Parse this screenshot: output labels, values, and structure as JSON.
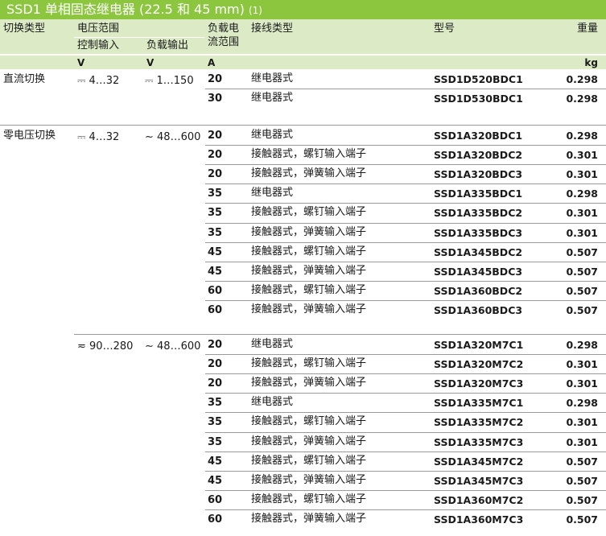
{
  "title": {
    "main": "SSD1 单相固态继电器 (22.5 和 45 mm)",
    "note": "(1)"
  },
  "header": {
    "switch_type": "切换类型",
    "voltage_range": "电压范围",
    "control_input": "控制输入",
    "load_output": "负载输出",
    "load_current_line1": "负载电",
    "load_current_line2": "流范围",
    "connection_type": "接线类型",
    "model": "型号",
    "weight": "重量"
  },
  "units": {
    "control": "V",
    "load": "V",
    "current": "A",
    "weight": "kg"
  },
  "groups": [
    {
      "switch_type": "直流切换",
      "control": "⎓ 4…32",
      "load": "⎓ 1…150",
      "rows": [
        {
          "current": "20",
          "connection": "继电器式",
          "model": "SSD1D520BDC1",
          "weight": "0.298"
        },
        {
          "current": "30",
          "connection": "继电器式",
          "model": "SSD1D530BDC1",
          "weight": "0.298"
        }
      ]
    },
    {
      "switch_type": "零电压切换",
      "control": "⎓ 4…32",
      "load": "∼ 48…600",
      "rows": [
        {
          "current": "20",
          "connection": "继电器式",
          "model": "SSD1A320BDC1",
          "weight": "0.298"
        },
        {
          "current": "20",
          "connection": "接触器式，螺钉输入端子",
          "model": "SSD1A320BDC2",
          "weight": "0.301"
        },
        {
          "current": "20",
          "connection": "接触器式，弹簧输入端子",
          "model": "SSD1A320BDC3",
          "weight": "0.301"
        },
        {
          "current": "35",
          "connection": "继电器式",
          "model": "SSD1A335BDC1",
          "weight": "0.298"
        },
        {
          "current": "35",
          "connection": "接触器式，螺钉输入端子",
          "model": "SSD1A335BDC2",
          "weight": "0.301"
        },
        {
          "current": "35",
          "connection": "接触器式，弹簧输入端子",
          "model": "SSD1A335BDC3",
          "weight": "0.301"
        },
        {
          "current": "45",
          "connection": "接触器式，螺钉输入端子",
          "model": "SSD1A345BDC2",
          "weight": "0.507"
        },
        {
          "current": "45",
          "connection": "接触器式，弹簧输入端子",
          "model": "SSD1A345BDC3",
          "weight": "0.507"
        },
        {
          "current": "60",
          "connection": "接触器式，螺钉输入端子",
          "model": "SSD1A360BDC2",
          "weight": "0.507"
        },
        {
          "current": "60",
          "connection": "接触器式，弹簧输入端子",
          "model": "SSD1A360BDC3",
          "weight": "0.507"
        }
      ]
    },
    {
      "switch_type": "",
      "control": "≂ 90…280",
      "load": "∼ 48…600",
      "rows": [
        {
          "current": "20",
          "connection": "继电器式",
          "model": "SSD1A320M7C1",
          "weight": "0.298"
        },
        {
          "current": "20",
          "connection": "接触器式，螺钉输入端子",
          "model": "SSD1A320M7C2",
          "weight": "0.301"
        },
        {
          "current": "20",
          "connection": "接触器式，弹簧输入端子",
          "model": "SSD1A320M7C3",
          "weight": "0.301"
        },
        {
          "current": "35",
          "connection": "继电器式",
          "model": "SSD1A335M7C1",
          "weight": "0.298"
        },
        {
          "current": "35",
          "connection": "接触器式，螺钉输入端子",
          "model": "SSD1A335M7C2",
          "weight": "0.301"
        },
        {
          "current": "35",
          "connection": "接触器式，弹簧输入端子",
          "model": "SSD1A335M7C3",
          "weight": "0.301"
        },
        {
          "current": "45",
          "connection": "接触器式，螺钉输入端子",
          "model": "SSD1A345M7C2",
          "weight": "0.507"
        },
        {
          "current": "45",
          "connection": "接触器式，弹簧输入端子",
          "model": "SSD1A345M7C3",
          "weight": "0.507"
        },
        {
          "current": "60",
          "connection": "接触器式，螺钉输入端子",
          "model": "SSD1A360M7C2",
          "weight": "0.507"
        },
        {
          "current": "60",
          "connection": "接触器式，弹簧输入端子",
          "model": "SSD1A360M7C3",
          "weight": "0.507"
        }
      ]
    }
  ]
}
